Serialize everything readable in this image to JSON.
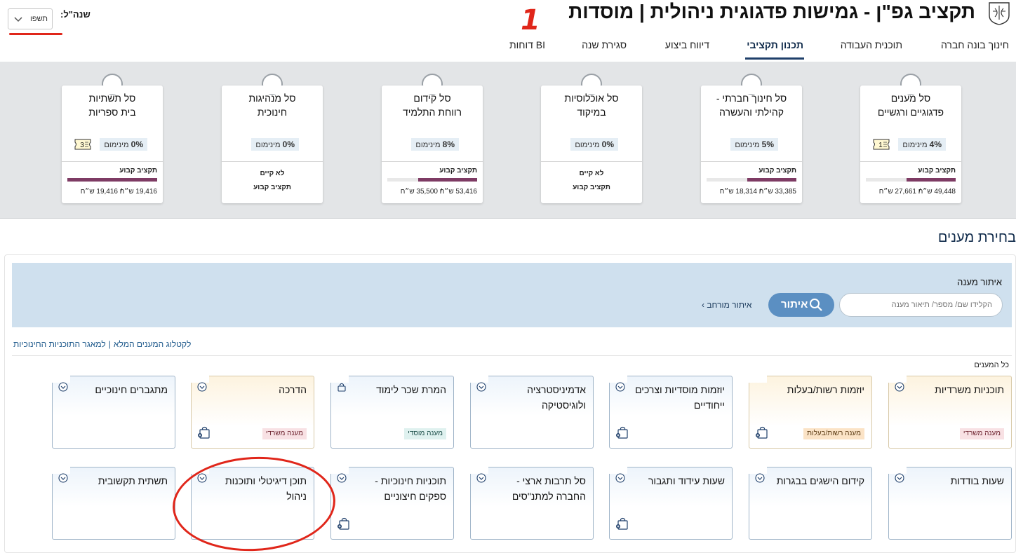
{
  "header": {
    "title": "תקציב גפ\"ן - גמישות פדגוגית ניהולית | מוסדות",
    "year_label": "שנה\"ל:",
    "year_value": "תשפו",
    "annotation_one": "1"
  },
  "tabs": [
    {
      "label": "חינוך בונה חברה"
    },
    {
      "label": "תוכנית העבודה"
    },
    {
      "label": "תכנון תקציבי"
    },
    {
      "label": "דיווח ביצוע"
    },
    {
      "label": "סגירת שנה"
    },
    {
      "label": "דוחות BI"
    }
  ],
  "baskets": [
    {
      "title1": "סל מענים",
      "title2": "פדגוגיים ורגשיים",
      "percent": "4%",
      "min_label": "מינימום",
      "ticket": "1",
      "fixed_label": "תקציב קבוע",
      "fill": 0.55,
      "amount1": "49,448",
      "amount2": "27,661",
      "currency": "ש״ח",
      "na": false
    },
    {
      "title1": "סל חינוך חברתי -",
      "title2": "קהילתי והעשרה",
      "percent": "5%",
      "min_label": "מינימום",
      "ticket": "",
      "fixed_label": "תקציב קבוע",
      "fill": 0.55,
      "amount1": "33,385",
      "amount2": "18,314",
      "currency": "ש״ח",
      "na": false
    },
    {
      "title1": "סל אוכלוסיות",
      "title2": "במיקוד",
      "percent": "0%",
      "min_label": "מינימום",
      "ticket": "",
      "na": true,
      "na1": "לא קיים",
      "na2": "תקציב קבוע"
    },
    {
      "title1": "סל קידום",
      "title2": "רווחת התלמיד",
      "percent": "8%",
      "min_label": "מינימום",
      "ticket": "",
      "fixed_label": "תקציב קבוע",
      "fill": 0.66,
      "amount1": "53,416",
      "amount2": "35,500",
      "currency": "ש״ח",
      "na": false
    },
    {
      "title1": "סל מנהיגות",
      "title2": "חינוכית",
      "percent": "0%",
      "min_label": "מינימום",
      "ticket": "",
      "na": true,
      "na1": "לא קיים",
      "na2": "תקציב קבוע"
    },
    {
      "title1": "סל תשתיות",
      "title2": "בית ספריות",
      "percent": "0%",
      "min_label": "מינימום",
      "ticket": "3",
      "fixed_label": "תקציב קבוע",
      "fill": 1.0,
      "amount1": "19,416",
      "amount2": "19,416",
      "currency": "ש״ח",
      "na": false
    }
  ],
  "section_heading": "בחירת מענים",
  "search": {
    "title": "איתור מענה",
    "placeholder": "הקלידו שם/ מספר/ תיאור מענה",
    "button": "איתור",
    "advanced": "איתור מורחב"
  },
  "links": {
    "catalog": "לקטלוג המענים המלא",
    "repository": "למאגר התוכניות החינוכיות"
  },
  "all_label": "כל המענים",
  "tiles_row1": [
    {
      "title": "תוכניות משרדיות",
      "badge": "מענה משרדי",
      "badge_type": "min",
      "icon": "chevron",
      "bag": false,
      "warm": true
    },
    {
      "title": "יוזמות רשות/בעלות",
      "badge": "מענה רשות/בעלות",
      "badge_type": "auth",
      "icon": "none",
      "bag": true,
      "warm": true
    },
    {
      "title": "יוזמות מוסדיות וצרכים ייחודיים",
      "badge": "",
      "badge_type": "",
      "icon": "chevron",
      "bag": true,
      "warm": false
    },
    {
      "title": "אדמיניסטרציה ולוגיסטיקה",
      "badge": "",
      "badge_type": "",
      "icon": "chevron",
      "bag": false,
      "warm": false
    },
    {
      "title": "המרת שכר לימוד",
      "badge": "מענה מוסדי",
      "badge_type": "inst",
      "icon": "lock",
      "bag": false,
      "warm": false
    },
    {
      "title": "הדרכה",
      "badge": "מענה משרדי",
      "badge_type": "min",
      "icon": "chevron",
      "bag": true,
      "warm": true
    },
    {
      "title": "מתגברים חינוכיים",
      "badge": "",
      "badge_type": "",
      "icon": "chevron",
      "bag": false,
      "warm": false
    }
  ],
  "tiles_row2": [
    {
      "title": "שעות בודדות",
      "icon": "chevron",
      "bag": false
    },
    {
      "title": "קידום הישגים בבגרות",
      "icon": "chevron",
      "bag": false
    },
    {
      "title": "שעות עידוד ותגבור",
      "icon": "chevron",
      "bag": true
    },
    {
      "title": "סל תרבות ארצי - החברה למתנ\"סים",
      "icon": "chevron",
      "bag": false
    },
    {
      "title": "תוכניות חינוכיות - ספקים חיצוניים",
      "icon": "chevron",
      "bag": true
    },
    {
      "title": "תוכן דיגיטלי ותוכנות ניהול",
      "icon": "chevron",
      "bag": false
    },
    {
      "title": "תשתית תקשובית",
      "icon": "chevron",
      "bag": false
    }
  ],
  "colors": {
    "bar": "#7e3b64",
    "nav_active": "#1f3f6a",
    "annotation": "#e0261a",
    "search_button": "#5b8fc2"
  }
}
